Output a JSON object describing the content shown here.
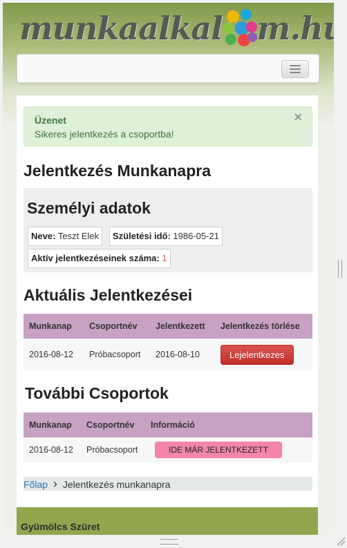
{
  "header": {
    "logo_prefix": "munkaalkal",
    "logo_suffix": "m.hu",
    "menu_toggle_icon": "hamburger-icon"
  },
  "alert": {
    "title": "Üzenet",
    "message": "Sikeres jelentkezés a csoportba!",
    "close_label": "×"
  },
  "page_title": "Jelentkezés Munkanapra",
  "personal": {
    "heading": "Személyi adatok",
    "name_label": "Neve:",
    "name_value": "Teszt Elek",
    "birth_label": "Születési idő:",
    "birth_value": "1986-05-21",
    "active_label": "Aktív jelentkezéseinek száma:",
    "active_value": "1"
  },
  "current": {
    "heading": "Aktuális Jelentkezései",
    "columns": [
      "Munkanap",
      "Csoportnév",
      "Jelentkezett",
      "Jelentkezés törlése"
    ],
    "rows": [
      {
        "day": "2016-08-12",
        "group": "Próbacsoport",
        "joined": "2016-08-10",
        "action": "Lejelentkezes"
      }
    ]
  },
  "other": {
    "heading": "További Csoportok",
    "columns": [
      "Munkanap",
      "Csoportnév",
      "Információ"
    ],
    "rows": [
      {
        "day": "2016-08-12",
        "group": "Próbacsoport",
        "info": "IDE MÁR JELENTKEZETT"
      }
    ]
  },
  "breadcrumb": {
    "home": "Főlap",
    "separator": "›",
    "current": "Jelentkezés munkanapra"
  },
  "footer": {
    "title": "Gyümölcs Szüret"
  },
  "colors": {
    "header_green": "#7f9a4a",
    "alert_bg": "#dff0d8",
    "alert_text": "#3c763d",
    "table_header": "#c7a2c4",
    "danger": "#d9534f",
    "pink_button": "#f386a8",
    "footer_green": "#93a64f"
  }
}
